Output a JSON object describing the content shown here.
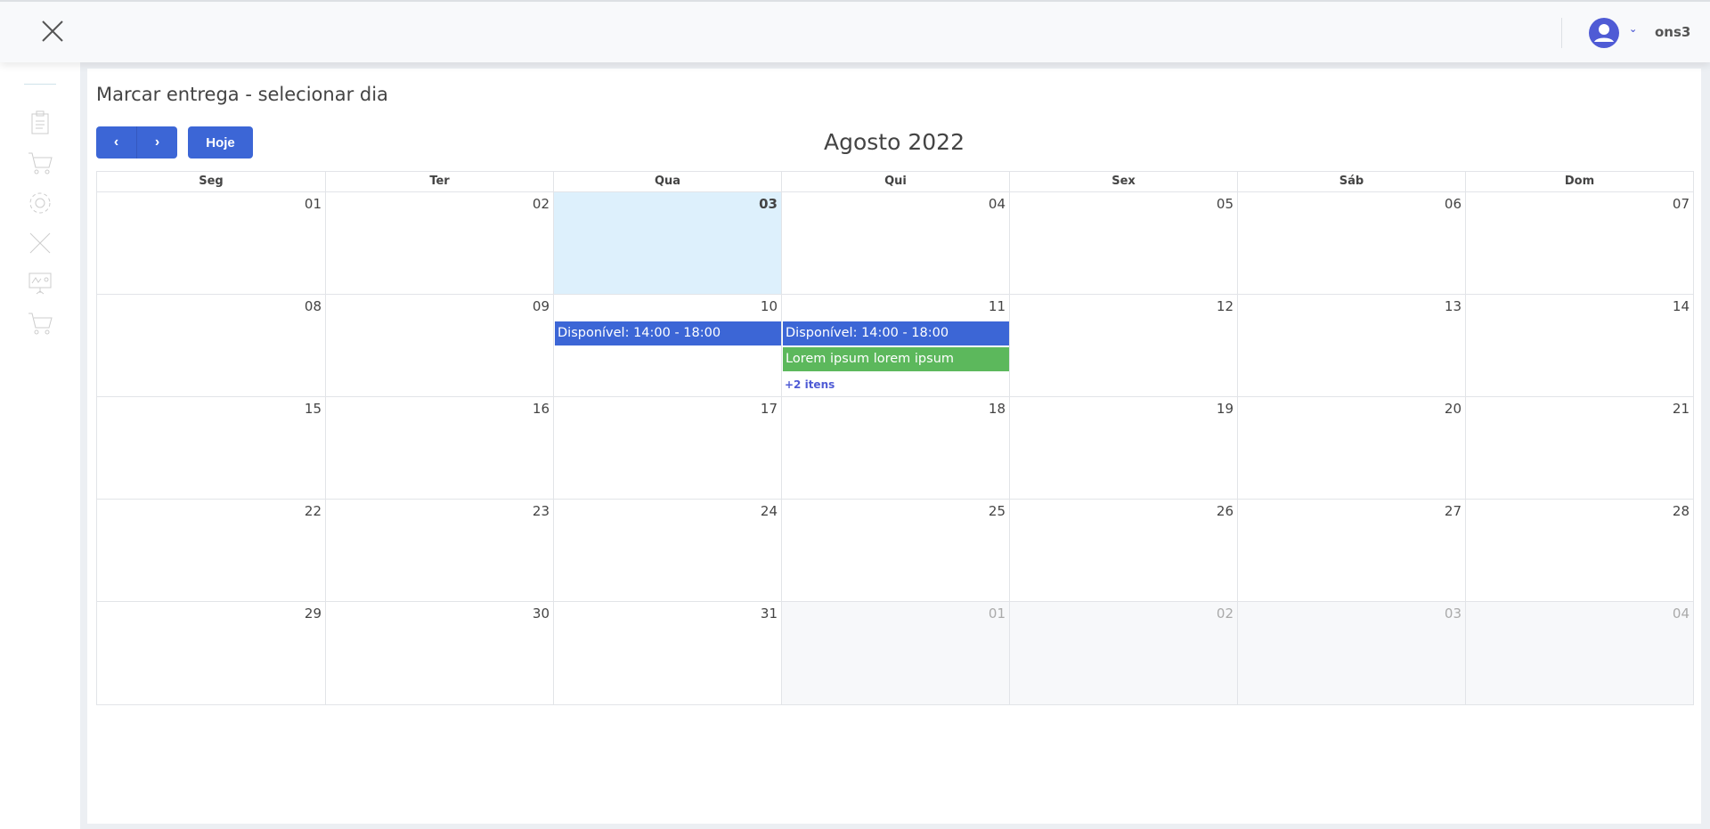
{
  "header": {
    "user_name": "ons3"
  },
  "page": {
    "title": "Marcar entrega - selecionar dia",
    "prev_label": "‹",
    "next_label": "›",
    "today_label": "Hoje",
    "month_title": "Agosto 2022"
  },
  "calendar": {
    "weekdays": [
      "Seg",
      "Ter",
      "Qua",
      "Qui",
      "Sex",
      "Sáb",
      "Dom"
    ],
    "weeks": [
      [
        "01",
        "02",
        "03",
        "04",
        "05",
        "06",
        "07"
      ],
      [
        "08",
        "09",
        "10",
        "11",
        "12",
        "13",
        "14"
      ],
      [
        "15",
        "16",
        "17",
        "18",
        "19",
        "20",
        "21"
      ],
      [
        "22",
        "23",
        "24",
        "25",
        "26",
        "27",
        "28"
      ],
      [
        "29",
        "30",
        "31",
        "01",
        "02",
        "03",
        "04"
      ]
    ],
    "today": "03",
    "events": {
      "w1d2": [
        {
          "title": "Disponível: 14:00 - 18:00",
          "color": "#3c66d6"
        }
      ],
      "w1d3": [
        {
          "title": "Disponível: 14:00 - 18:00",
          "color": "#3c66d6"
        },
        {
          "title": "Lorem ipsum lorem ipsum",
          "color": "#5cb85c"
        }
      ]
    },
    "more": {
      "w1d3": "+2 itens"
    }
  },
  "colors": {
    "primary": "#3c66d6",
    "success": "#5cb85c",
    "today_bg": "#ddf0fc"
  }
}
